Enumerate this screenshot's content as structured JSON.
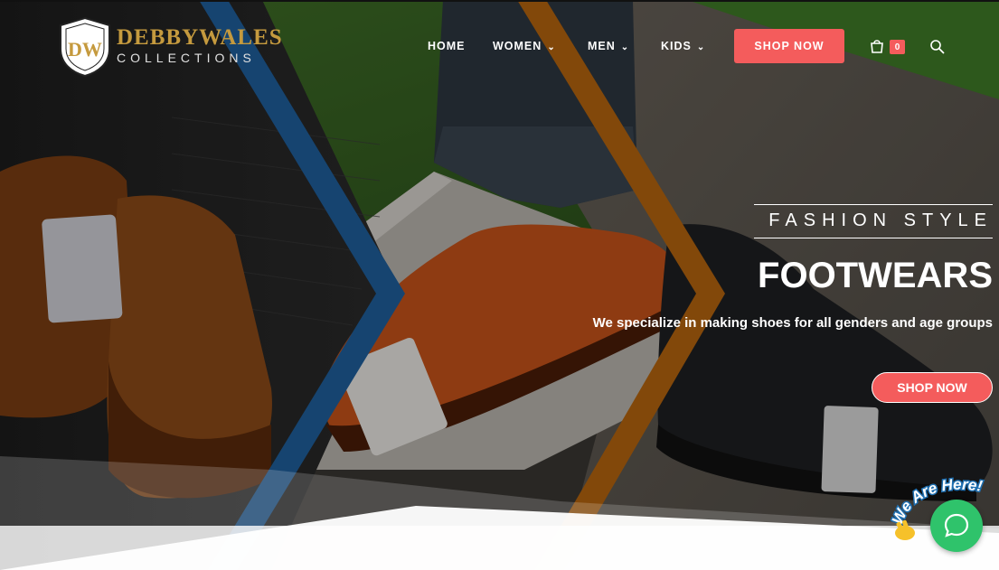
{
  "brand": {
    "name_line1": "DEBBYWALES",
    "name_line2": "COLLECTIONS",
    "badge_initials": "DW"
  },
  "nav": {
    "items": [
      {
        "label": "HOME",
        "dropdown": false
      },
      {
        "label": "WOMEN",
        "dropdown": true
      },
      {
        "label": "MEN",
        "dropdown": true
      },
      {
        "label": "KIDS",
        "dropdown": true
      }
    ],
    "shop_button": "SHOP NOW",
    "cart_count": "0"
  },
  "hero": {
    "tagline": "FASHION STYLE",
    "title": "FOOTWEARS",
    "description": "We specialize in making  shoes  for all genders and age groups",
    "cta": "SHOP NOW"
  },
  "chat": {
    "label": "We Are Here!"
  },
  "colors": {
    "accent": "#f45c5c",
    "brand_gold": "#c59a3e",
    "chevron_blue": "#1f5f9c",
    "chevron_orange": "#b5650e",
    "chat_green": "#2fc36b"
  },
  "icons": {
    "cart": "shopping-bag-icon",
    "search": "search-icon",
    "chat": "chat-bubble-icon",
    "wave": "waving-hand-icon"
  }
}
